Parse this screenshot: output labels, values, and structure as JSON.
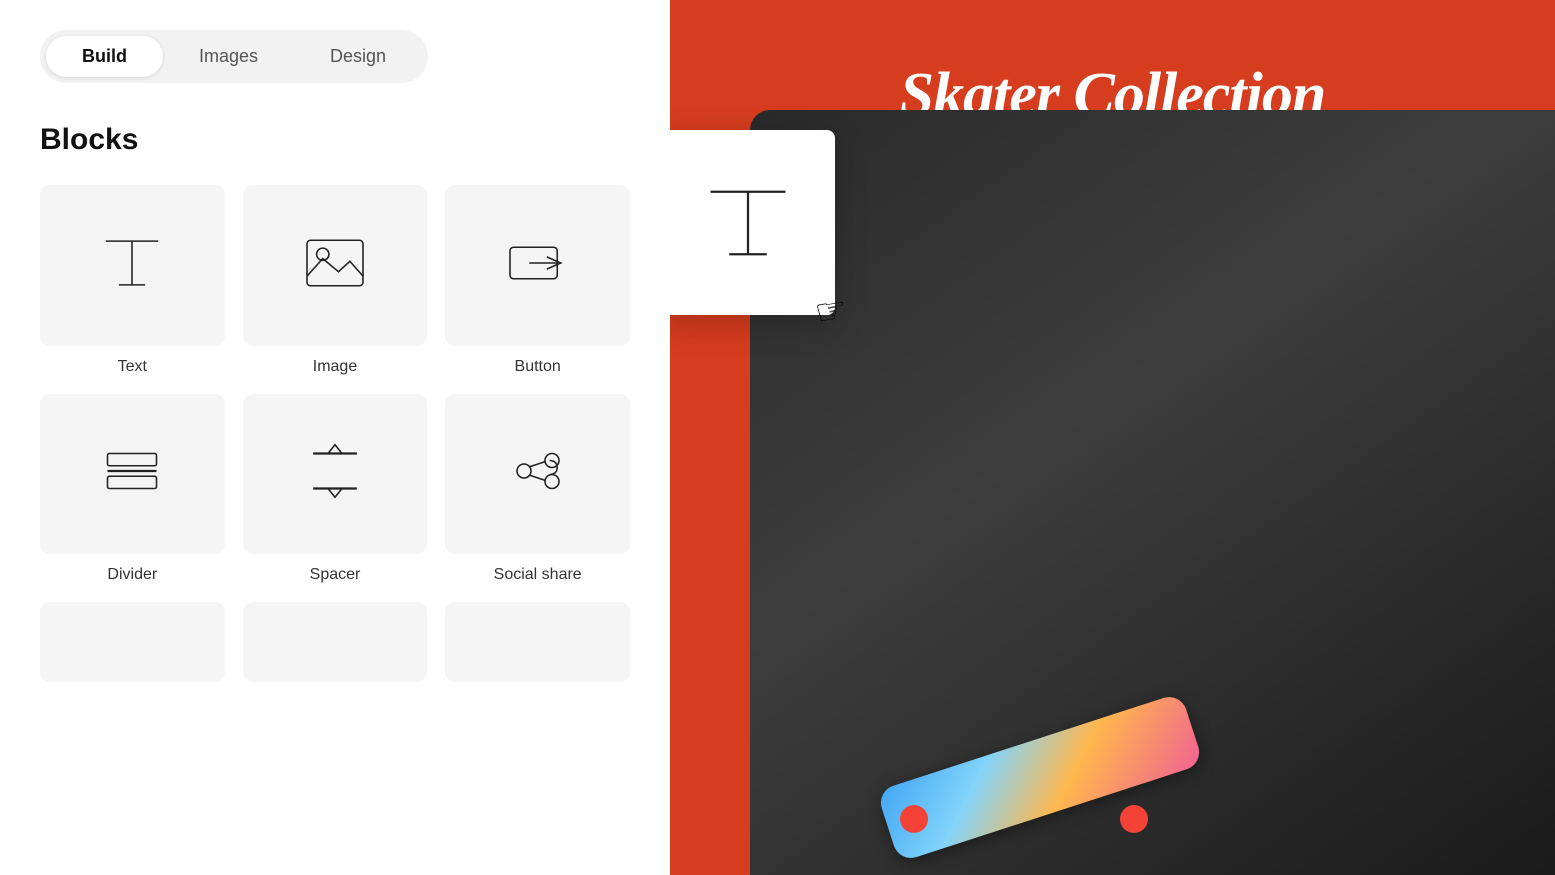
{
  "tabs": [
    {
      "id": "build",
      "label": "Build",
      "active": true
    },
    {
      "id": "images",
      "label": "Images",
      "active": false
    },
    {
      "id": "design",
      "label": "Design",
      "active": false
    }
  ],
  "blocks_title": "Blocks",
  "blocks": [
    {
      "id": "text",
      "label": "Text",
      "icon": "text-icon"
    },
    {
      "id": "image",
      "label": "Image",
      "icon": "image-icon"
    },
    {
      "id": "button",
      "label": "Button",
      "icon": "button-icon"
    },
    {
      "id": "divider",
      "label": "Divider",
      "icon": "divider-icon"
    },
    {
      "id": "spacer",
      "label": "Spacer",
      "icon": "spacer-icon"
    },
    {
      "id": "social-share",
      "label": "Social share",
      "icon": "social-share-icon"
    }
  ],
  "poster": {
    "title": "Skater Collection"
  },
  "drag_card": {
    "label": "Text"
  }
}
